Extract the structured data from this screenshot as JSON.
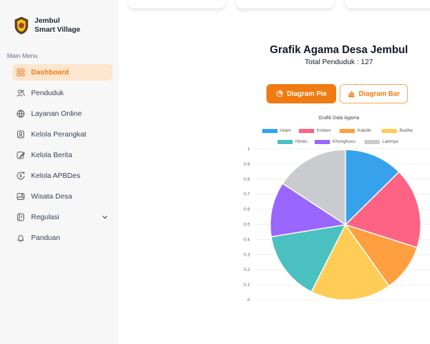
{
  "brand": {
    "line1": "Jembul",
    "line2": "Smart Village"
  },
  "sidebar": {
    "menu_title": "Main Menu",
    "items": [
      {
        "label": "Dashboard",
        "icon": "grid-icon",
        "active": true
      },
      {
        "label": "Penduduk",
        "icon": "users-icon"
      },
      {
        "label": "Layanan Online",
        "icon": "globe-icon"
      },
      {
        "label": "Kelola Perangkat",
        "icon": "id-card-icon"
      },
      {
        "label": "Kelola Berita",
        "icon": "edit-icon"
      },
      {
        "label": "Kelola APBDes",
        "icon": "coin-icon"
      },
      {
        "label": "Wisata Desa",
        "icon": "image-icon"
      },
      {
        "label": "Regulasi",
        "icon": "book-icon",
        "has_submenu": true
      },
      {
        "label": "Panduan",
        "icon": "bell-icon"
      }
    ]
  },
  "main": {
    "title": "Grafik Agama Desa Jembul",
    "subtitle": "Total Penduduk : 127",
    "buttons": {
      "pie": "Diagram Pie",
      "bar": "Diagram Bar"
    }
  },
  "colors": {
    "accent": "#f07b12",
    "active_bg": "#fde5cf",
    "sidebar_bg": "#f7f7f8"
  },
  "chart_data": {
    "type": "pie",
    "title": "Grafik Data Agama",
    "categories": [
      "Islam",
      "Kristen",
      "Katolik",
      "Budha",
      "Hindu",
      "Khonghucu",
      "Lainnya"
    ],
    "values": [
      16,
      22,
      13,
      22,
      19,
      15,
      20
    ],
    "colors": [
      "#36a2eb",
      "#ff6384",
      "#ff9f40",
      "#ffcd56",
      "#4bc0c0",
      "#9966ff",
      "#c9cbcf"
    ],
    "legend_position": "top",
    "y_ticks": [
      "1",
      "0.9",
      "0.8",
      "0.7",
      "0.6",
      "0.5",
      "0.4",
      "0.3",
      "0.2",
      "0.1",
      "0"
    ]
  }
}
